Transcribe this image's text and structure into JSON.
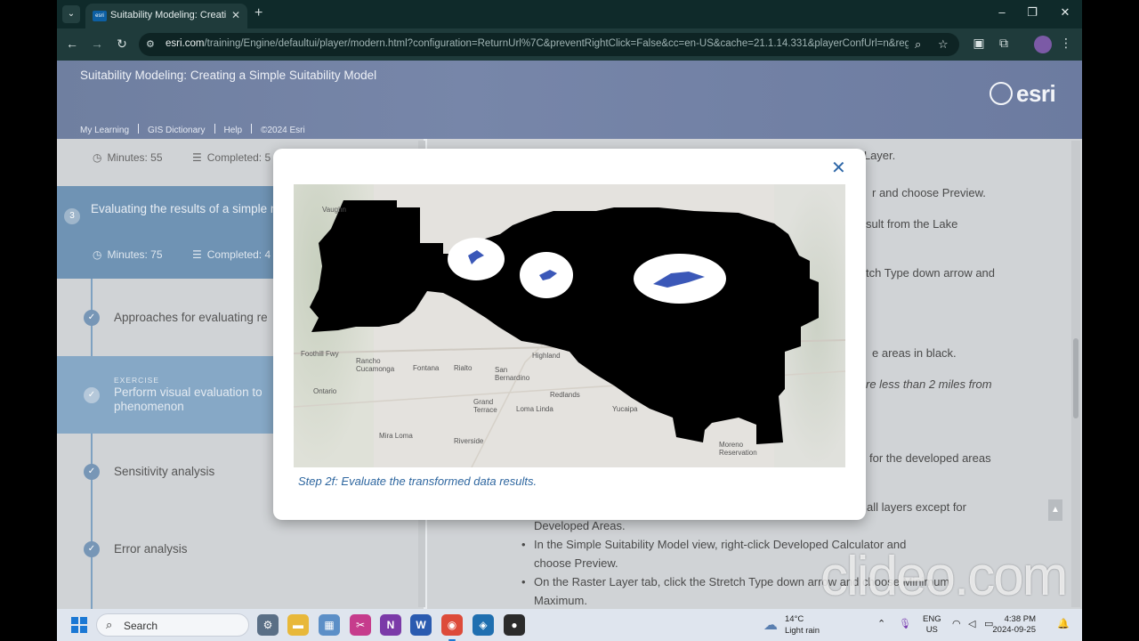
{
  "browser": {
    "tab_title": "Suitability Modeling: Creating a",
    "tab_favicon": "esri",
    "url_host": "esri.com",
    "url_path": "/training/Engine/defaultui/player/modern.html?configuration=ReturnUrl%7C&preventRightClick=False&cc=en-US&cache=21.1.14.331&playerConfUrl=n&regist..."
  },
  "header": {
    "course_title": "Suitability Modeling: Creating a Simple Suitability Model",
    "logo_text": "esri",
    "links": [
      "My Learning",
      "GIS Dictionary",
      "Help",
      "©2024 Esri"
    ]
  },
  "sidebar": {
    "top_meta": {
      "minutes": "Minutes: 55",
      "completed": "Completed: 5"
    },
    "active_section": {
      "number": "3",
      "title": "Evaluating the results of a simple model",
      "minutes": "Minutes: 75",
      "completed": "Completed: 4"
    },
    "items": [
      {
        "label": "Approaches for evaluating re"
      },
      {
        "tag": "EXERCISE",
        "label": "Perform visual evaluation to phenomenon"
      },
      {
        "label": "Sensitivity analysis"
      },
      {
        "label": "Error analysis"
      }
    ]
  },
  "content": {
    "lines": [
      "o Layer.",
      "r and choose Preview.",
      "sult from the Lake",
      "tch Type down arrow and",
      "e areas in black.",
      "re less than 2 miles from",
      "for the developed areas",
      "all layers except for"
    ],
    "bullet_continuation": "Developed Areas.",
    "bullets": [
      "In the Simple Suitability Model view, right-click Developed Calculator and",
      "choose Preview.",
      "On the Raster Layer tab, click the Stretch Type down arrow and choose Minimum",
      "Maximum."
    ]
  },
  "modal": {
    "close_glyph": "✕",
    "caption": "Step 2f: Evaluate the transformed data results.",
    "map_labels": [
      "Vaughn",
      "Foothill Fwy",
      "Rancho Cucamonga",
      "Fontana",
      "Rialto",
      "San Bernardino",
      "Highland",
      "Ontario",
      "Grand Terrace",
      "Redlands",
      "Loma Linda",
      "Yucaipa",
      "Mira Loma",
      "Riverside",
      "Moreno Reservation"
    ]
  },
  "watermark": "clideo.com",
  "taskbar": {
    "search_label": "Search",
    "weather_temp": "14°C",
    "weather_desc": "Light rain",
    "lang_line1": "ENG",
    "lang_line2": "US",
    "time": "4:38 PM",
    "date": "2024-09-25"
  },
  "colors": {
    "modal_caption": "#2f67a0",
    "close_icon": "#2f68a8",
    "sidebar_active": "#6f93b4",
    "header_bg": "#7786a9"
  }
}
